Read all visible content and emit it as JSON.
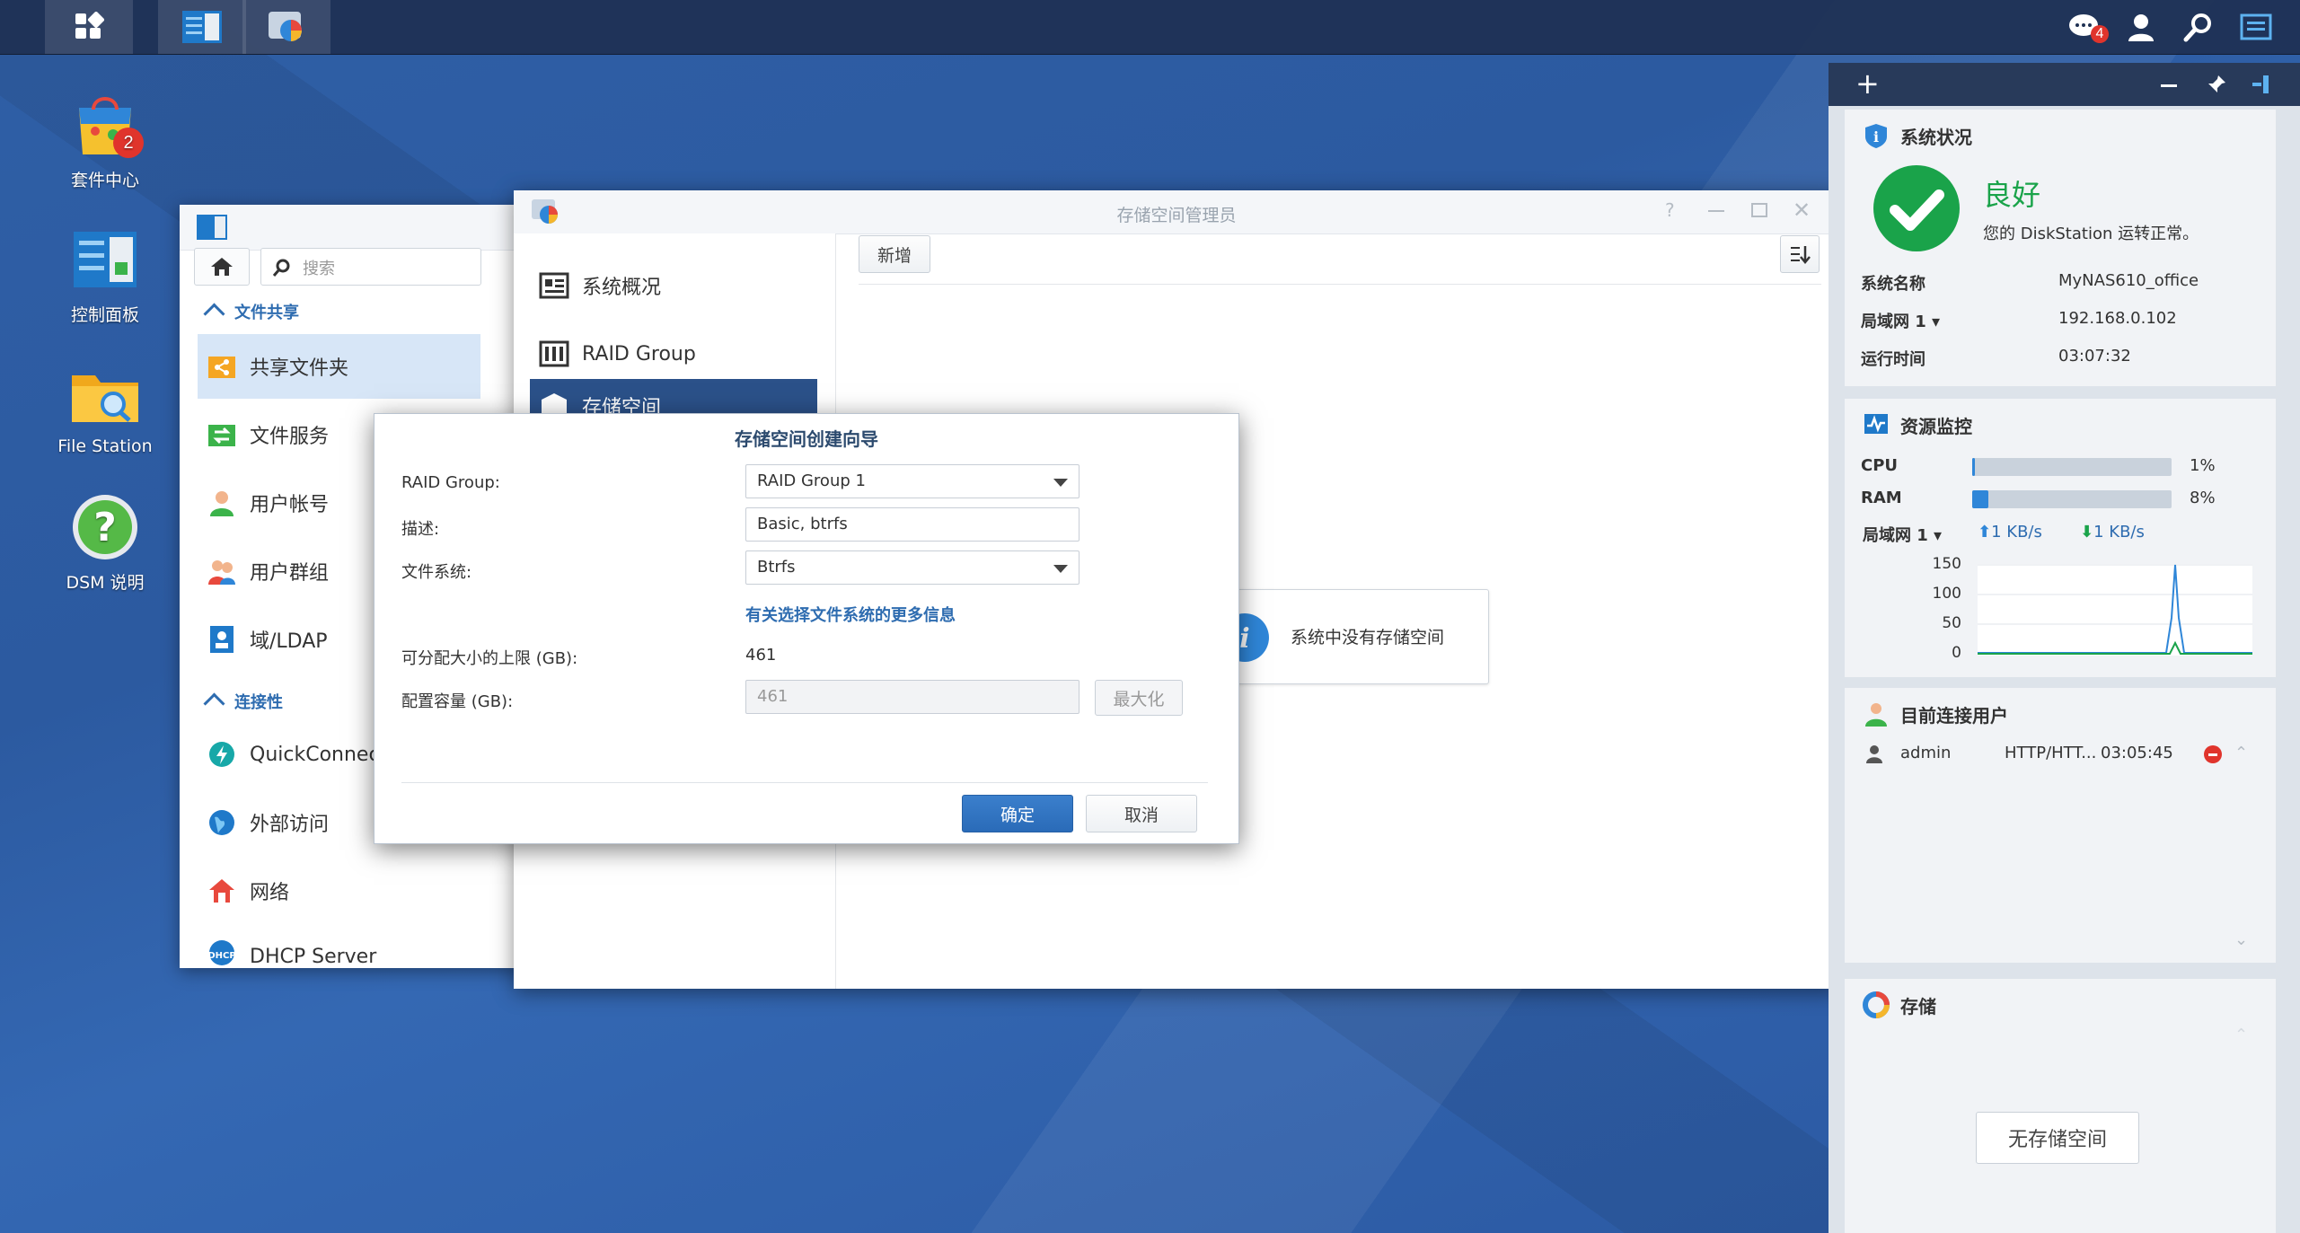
{
  "taskbar": {
    "notification_count": "4"
  },
  "desktop": {
    "icons": [
      {
        "label": "套件中心",
        "badge": "2"
      },
      {
        "label": "控制面板"
      },
      {
        "label": "File Station"
      },
      {
        "label": "DSM 说明"
      }
    ]
  },
  "control_panel": {
    "search_placeholder": "搜索",
    "section_file_sharing": "文件共享",
    "section_connectivity": "连接性",
    "items": [
      {
        "label": "共享文件夹"
      },
      {
        "label": "文件服务"
      },
      {
        "label": "用户帐号"
      },
      {
        "label": "用户群组"
      },
      {
        "label": "域/LDAP"
      },
      {
        "label": "QuickConnect"
      },
      {
        "label": "外部访问"
      },
      {
        "label": "网络"
      },
      {
        "label": "DHCP Server"
      }
    ]
  },
  "storage_manager": {
    "title": "存储空间管理员",
    "nav": [
      {
        "label": "系统概况"
      },
      {
        "label": "RAID Group"
      },
      {
        "label": "存储空间"
      }
    ],
    "add_button": "新增",
    "empty_message": "系统中没有存储空间"
  },
  "dialog": {
    "title": "存储空间创建向导",
    "raid_group_label": "RAID Group:",
    "raid_group_value": "RAID Group 1",
    "description_label": "描述:",
    "description_value": "Basic, btrfs",
    "filesystem_label": "文件系统:",
    "filesystem_value": "Btrfs",
    "more_info_link": "有关选择文件系统的更多信息",
    "max_size_label": "可分配大小的上限 (GB):",
    "max_size_value": "461",
    "capacity_label": "配置容量 (GB):",
    "capacity_value": "461",
    "maximize_button": "最大化",
    "ok_button": "确定",
    "cancel_button": "取消"
  },
  "widgets": {
    "system_status": {
      "title": "系统状况",
      "status": "良好",
      "status_desc": "您的 DiskStation 运转正常。",
      "rows": [
        {
          "key": "系统名称",
          "value": "MyNAS610_office"
        },
        {
          "key": "局域网 1 ▾",
          "value": "192.168.0.102"
        },
        {
          "key": "运行时间",
          "value": "03:07:32"
        }
      ]
    },
    "resource_monitor": {
      "title": "资源监控",
      "cpu_label": "CPU",
      "cpu_value": "1%",
      "cpu_fraction": 0.01,
      "ram_label": "RAM",
      "ram_value": "8%",
      "ram_fraction": 0.08,
      "lan_label": "局域网 1 ▾",
      "upload": "1 KB/s",
      "download": "1 KB/s",
      "y_ticks": [
        "150",
        "100",
        "50",
        "0"
      ]
    },
    "connected_users": {
      "title": "目前连接用户",
      "user": "admin",
      "protocol": "HTTP/HTT...",
      "time": "03:05:45"
    },
    "storage": {
      "title": "存储",
      "empty_button": "无存储空间"
    }
  },
  "colors": {
    "accent": "#2f86d8",
    "primary_button": "#2a6bb8",
    "status_green": "#1aa34a"
  }
}
